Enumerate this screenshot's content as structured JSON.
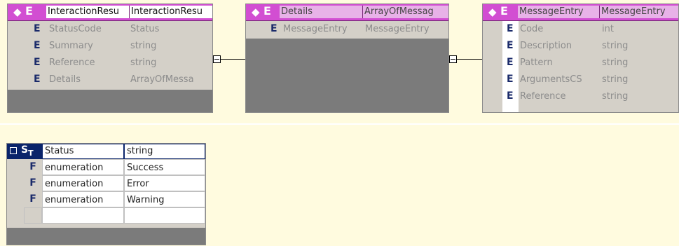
{
  "entities": [
    {
      "kind_label": "E",
      "header": {
        "name": "InteractionResu",
        "type": "InteractionResu"
      },
      "rows": [
        {
          "kind": "E",
          "name": "StatusCode",
          "type": "Status"
        },
        {
          "kind": "E",
          "name": "Summary",
          "type": "string"
        },
        {
          "kind": "E",
          "name": "Reference",
          "type": "string"
        },
        {
          "kind": "E",
          "name": "Details",
          "type": "ArrayOfMessa"
        }
      ]
    },
    {
      "kind_label": "E",
      "header": {
        "name": "Details",
        "type": "ArrayOfMessag"
      },
      "rows": [
        {
          "kind": "E",
          "name": "MessageEntry",
          "type": "MessageEntry"
        }
      ]
    },
    {
      "kind_label": "E",
      "header": {
        "name": "MessageEntry",
        "type": "MessageEntry"
      },
      "rows": [
        {
          "kind": "E",
          "name": "Code",
          "type": "int"
        },
        {
          "kind": "E",
          "name": "Description",
          "type": "string"
        },
        {
          "kind": "E",
          "name": "Pattern",
          "type": "string"
        },
        {
          "kind": "E",
          "name": "ArgumentsCS",
          "type": "string"
        },
        {
          "kind": "E",
          "name": "Reference",
          "type": "string"
        }
      ]
    }
  ],
  "simple_type": {
    "badge": "S",
    "badge_sub": "T",
    "header": {
      "name": "Status",
      "type": "string"
    },
    "rows": [
      {
        "kind": "F",
        "facet": "enumeration",
        "value": "Success"
      },
      {
        "kind": "F",
        "facet": "enumeration",
        "value": "Error"
      },
      {
        "kind": "F",
        "facet": "enumeration",
        "value": "Warning"
      }
    ]
  },
  "icons": {
    "entity_header": "diamond-icon",
    "connector": "collapse-box-icon",
    "table_toggle": "square-icon"
  },
  "colors": {
    "entity_header": "#d24ed2",
    "simple_header": "#0a246a",
    "background": "#fffbdf"
  }
}
